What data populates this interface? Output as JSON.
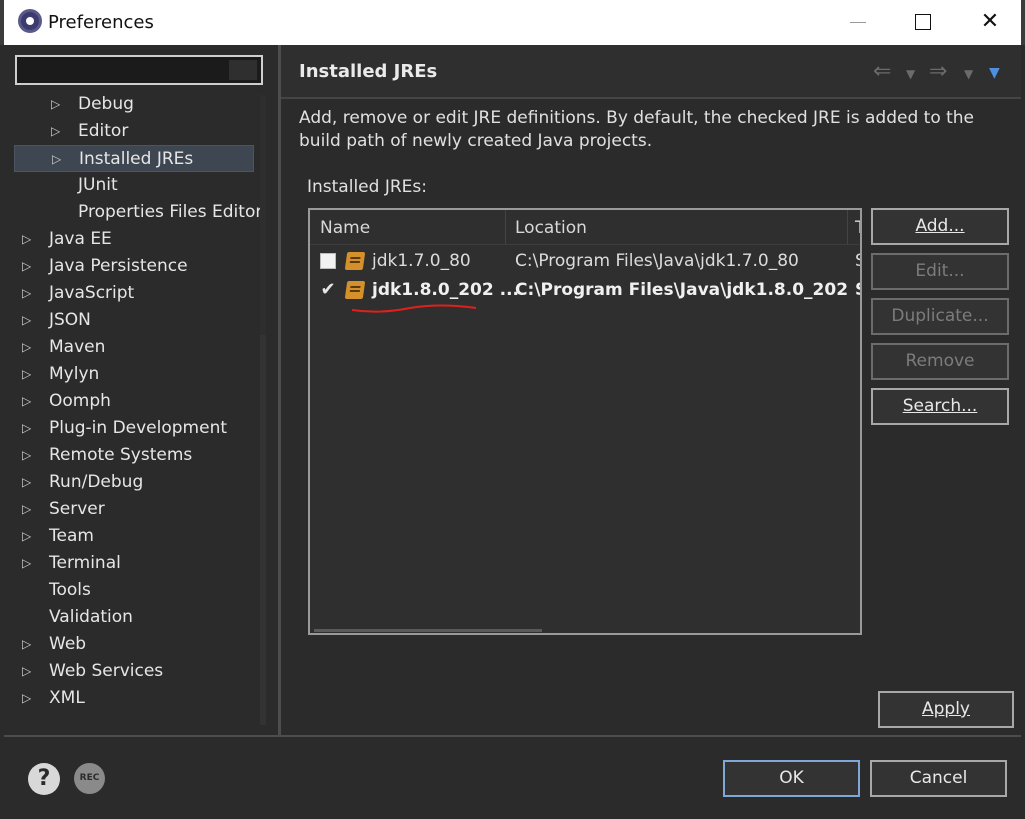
{
  "window": {
    "title": "Preferences",
    "minimize_label": "",
    "close_label": "✕"
  },
  "sidebar": {
    "filter_value": "",
    "items": [
      {
        "label": "Debug",
        "indent": 1,
        "expandable": true
      },
      {
        "label": "Editor",
        "indent": 1,
        "expandable": true
      },
      {
        "label": "Installed JREs",
        "indent": 1,
        "expandable": true,
        "selected": true
      },
      {
        "label": "JUnit",
        "indent": 1,
        "expandable": false
      },
      {
        "label": "Properties Files Editor",
        "indent": 1,
        "expandable": false
      },
      {
        "label": "Java EE",
        "indent": 0,
        "expandable": true
      },
      {
        "label": "Java Persistence",
        "indent": 0,
        "expandable": true
      },
      {
        "label": "JavaScript",
        "indent": 0,
        "expandable": true
      },
      {
        "label": "JSON",
        "indent": 0,
        "expandable": true
      },
      {
        "label": "Maven",
        "indent": 0,
        "expandable": true
      },
      {
        "label": "Mylyn",
        "indent": 0,
        "expandable": true
      },
      {
        "label": "Oomph",
        "indent": 0,
        "expandable": true
      },
      {
        "label": "Plug-in Development",
        "indent": 0,
        "expandable": true
      },
      {
        "label": "Remote Systems",
        "indent": 0,
        "expandable": true
      },
      {
        "label": "Run/Debug",
        "indent": 0,
        "expandable": true
      },
      {
        "label": "Server",
        "indent": 0,
        "expandable": true
      },
      {
        "label": "Team",
        "indent": 0,
        "expandable": true
      },
      {
        "label": "Terminal",
        "indent": 0,
        "expandable": true
      },
      {
        "label": "Tools",
        "indent": 0,
        "expandable": false
      },
      {
        "label": "Validation",
        "indent": 0,
        "expandable": false
      },
      {
        "label": "Web",
        "indent": 0,
        "expandable": true
      },
      {
        "label": "Web Services",
        "indent": 0,
        "expandable": true
      },
      {
        "label": "XML",
        "indent": 0,
        "expandable": true
      }
    ]
  },
  "page": {
    "title": "Installed JREs",
    "description": "Add, remove or edit JRE definitions. By default, the checked JRE is added to the build path of newly created Java projects.",
    "section_label": "Installed JREs:",
    "table": {
      "columns": [
        "Name",
        "Location",
        "T"
      ],
      "rows": [
        {
          "checked": false,
          "name": "jdk1.7.0_80",
          "location": "C:\\Program Files\\Java\\jdk1.7.0_80",
          "type": "S"
        },
        {
          "checked": true,
          "name": "jdk1.8.0_202 ...",
          "location": "C:\\Program Files\\Java\\jdk1.8.0_202",
          "type": "S"
        }
      ]
    },
    "buttons": {
      "add": "Add...",
      "edit": "Edit...",
      "duplicate": "Duplicate...",
      "remove": "Remove",
      "search": "Search...",
      "apply": "Apply"
    }
  },
  "footer": {
    "help_icon": "?",
    "rec_icon": "REC",
    "ok": "OK",
    "cancel": "Cancel"
  },
  "colors": {
    "background": "#2b2b2b",
    "selection": "#3d4651",
    "jre_icon": "#d4902a",
    "annotation_red": "#e0201a",
    "ok_border": "#7fa8d8"
  }
}
